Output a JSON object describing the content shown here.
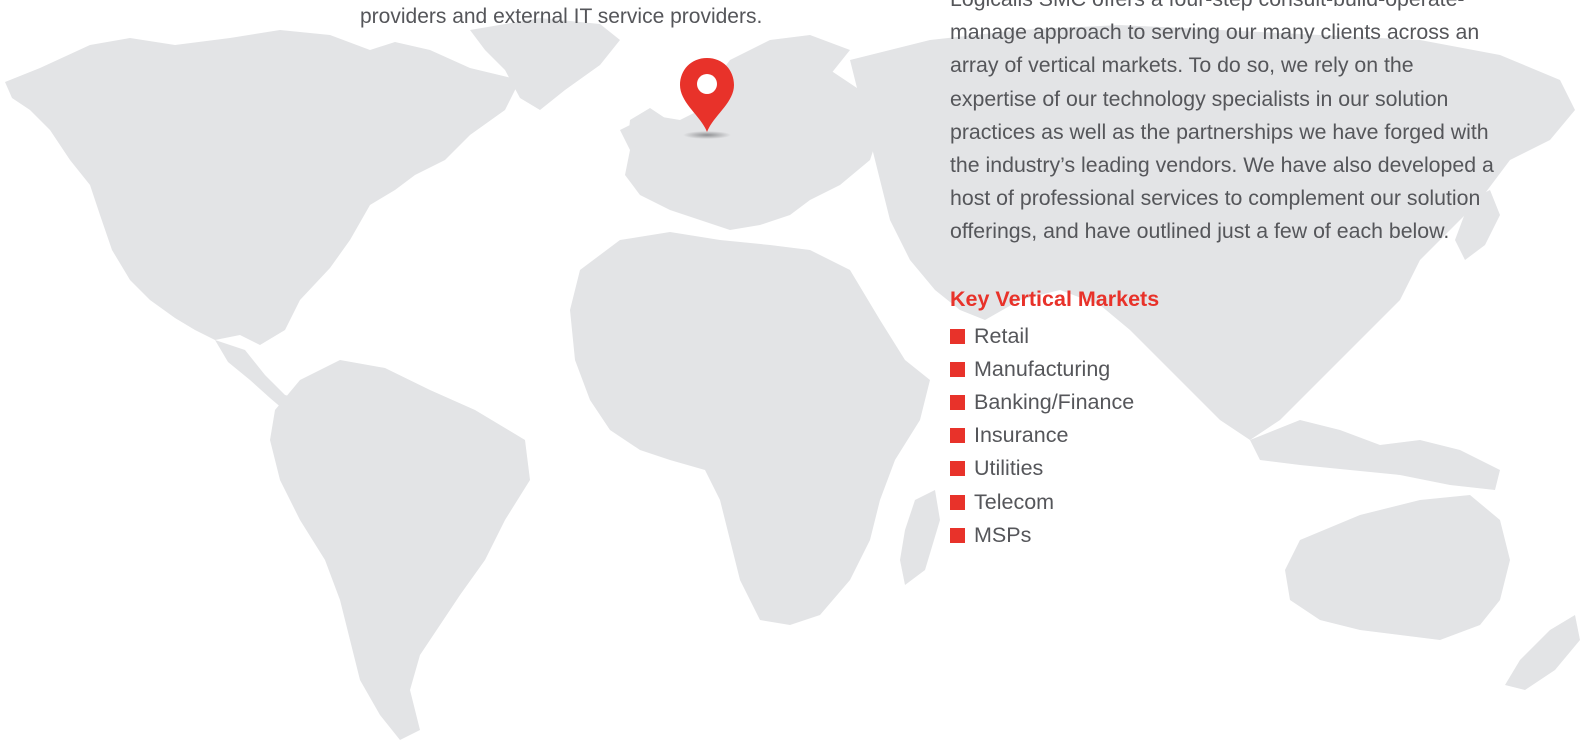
{
  "left_column": {
    "text_fragment": "providers and external IT service providers."
  },
  "right_column": {
    "intro_paragraph": "Logicalis SMC offers a four-step consult-build-operate-manage approach to serving our many clients across an array of vertical markets. To do so, we rely on the expertise of our technology specialists in our solution practices as well as the partnerships we have forged with the industry’s leading vendors. We have also developed a host of professional services to complement our solution offerings, and have outlined just a few of each below.",
    "markets_heading": "Key Vertical Markets",
    "markets": [
      {
        "label": "Retail"
      },
      {
        "label": "Manufacturing"
      },
      {
        "label": "Banking/Finance"
      },
      {
        "label": "Insurance"
      },
      {
        "label": "Utilities"
      },
      {
        "label": "Telecom"
      },
      {
        "label": "MSPs"
      }
    ]
  },
  "map": {
    "icon": "location-pin-icon"
  },
  "colors": {
    "accent": "#e8322a",
    "body_text": "#55565a",
    "map_fill": "#e3e4e6",
    "background": "#ffffff"
  }
}
